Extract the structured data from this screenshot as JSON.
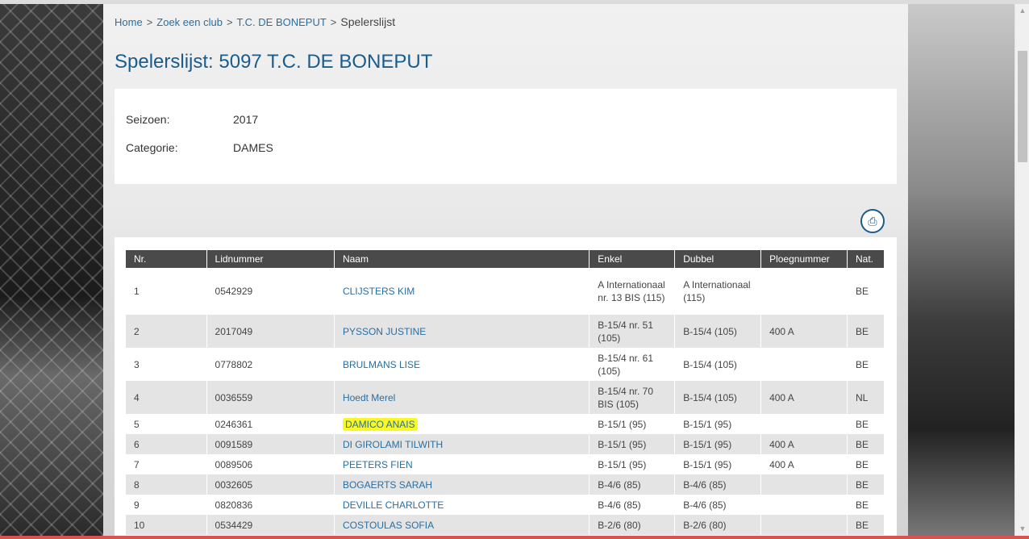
{
  "breadcrumb": {
    "home": "Home",
    "sep": ">",
    "zoek": "Zoek een club",
    "club": "T.C. DE BONEPUT",
    "current": "Spelerslijst"
  },
  "page_title": "Spelerslijst: 5097 T.C. DE BONEPUT",
  "info": {
    "season_label": "Seizoen:",
    "season_value": "2017",
    "category_label": "Categorie:",
    "category_value": "DAMES"
  },
  "print_icon": "printer-icon",
  "table": {
    "headers": [
      "Nr.",
      "Lidnummer",
      "Naam",
      "Enkel",
      "Dubbel",
      "Ploegnummer",
      "Nat."
    ],
    "rows": [
      {
        "nr": "1",
        "lid": "0542929",
        "naam": "CLIJSTERS KIM",
        "enkel": "A Internationaal nr. 13 BIS (115)",
        "dubbel": "A Internationaal (115)",
        "ploeg": "",
        "nat": "BE"
      },
      {
        "nr": "2",
        "lid": "2017049",
        "naam": "PYSSON JUSTINE",
        "enkel": "B-15/4 nr. 51 (105)",
        "dubbel": "B-15/4 (105)",
        "ploeg": "400 A",
        "nat": "BE"
      },
      {
        "nr": "3",
        "lid": "0778802",
        "naam": "BRULMANS LISE",
        "enkel": "B-15/4 nr. 61 (105)",
        "dubbel": "B-15/4 (105)",
        "ploeg": "",
        "nat": "BE"
      },
      {
        "nr": "4",
        "lid": "0036559",
        "naam": "Hoedt Merel",
        "enkel": "B-15/4 nr. 70 BIS (105)",
        "dubbel": "B-15/4 (105)",
        "ploeg": "400 A",
        "nat": "NL"
      },
      {
        "nr": "5",
        "lid": "0246361",
        "naam": "DAMICO ANAIS",
        "enkel": "B-15/1 (95)",
        "dubbel": "B-15/1 (95)",
        "ploeg": "",
        "nat": "BE",
        "highlight": true
      },
      {
        "nr": "6",
        "lid": "0091589",
        "naam": "DI GIROLAMI TILWITH",
        "enkel": "B-15/1 (95)",
        "dubbel": "B-15/1 (95)",
        "ploeg": "400 A",
        "nat": "BE"
      },
      {
        "nr": "7",
        "lid": "0089506",
        "naam": "PEETERS FIEN",
        "enkel": "B-15/1 (95)",
        "dubbel": "B-15/1 (95)",
        "ploeg": "400 A",
        "nat": "BE"
      },
      {
        "nr": "8",
        "lid": "0032605",
        "naam": "BOGAERTS SARAH",
        "enkel": "B-4/6 (85)",
        "dubbel": "B-4/6 (85)",
        "ploeg": "",
        "nat": "BE"
      },
      {
        "nr": "9",
        "lid": "0820836",
        "naam": "DEVILLE CHARLOTTE",
        "enkel": "B-4/6 (85)",
        "dubbel": "B-4/6 (85)",
        "ploeg": "",
        "nat": "BE"
      },
      {
        "nr": "10",
        "lid": "0534429",
        "naam": "COSTOULAS SOFIA",
        "enkel": "B-2/6 (80)",
        "dubbel": "B-2/6 (80)",
        "ploeg": "",
        "nat": "BE"
      }
    ]
  },
  "colors": {
    "link": "#2a6ea0",
    "title": "#1a5c8c",
    "header_bg": "#4a4a4a",
    "row_alt": "#e4e4e4",
    "highlight": "#f7f72a"
  }
}
